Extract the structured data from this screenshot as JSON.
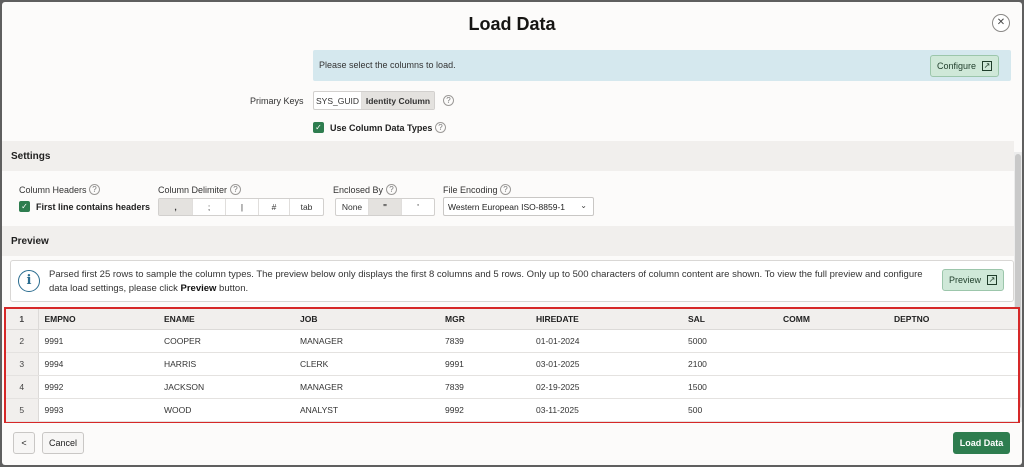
{
  "dialog": {
    "title": "Load Data",
    "close_glyph": "✕"
  },
  "banner": {
    "message": "Please select the columns to load.",
    "configure_label": "Configure"
  },
  "primary_keys": {
    "label": "Primary Keys",
    "options": [
      "SYS_GUID",
      "Identity Column"
    ],
    "selected": "Identity Column"
  },
  "use_column_data_types": {
    "label": "Use Column Data Types",
    "checked": true
  },
  "settings": {
    "title": "Settings",
    "column_headers": {
      "label": "Column Headers",
      "checkbox_label": "First line contains headers"
    },
    "column_delimiter": {
      "label": "Column Delimiter",
      "options": [
        ",",
        ";",
        "|",
        "#",
        "tab"
      ],
      "selected": ","
    },
    "enclosed_by": {
      "label": "Enclosed By",
      "options": [
        "None",
        "\"",
        "'"
      ],
      "selected": "\""
    },
    "file_encoding": {
      "label": "File Encoding",
      "value": "Western European ISO-8859-1"
    }
  },
  "preview": {
    "title": "Preview",
    "info_text_before": "Parsed first 25 rows to sample the column types. The preview below only displays the first 8 columns and 5 rows. Only up to 500 characters of column content are shown. To view the full preview and configure data load settings, please click ",
    "info_text_bold": "Preview",
    "info_text_after": " button.",
    "preview_button": "Preview"
  },
  "grid": {
    "header_row_number": "1",
    "columns": [
      "EMPNO",
      "ENAME",
      "JOB",
      "MGR",
      "HIREDATE",
      "SAL",
      "COMM",
      "DEPTNO"
    ],
    "rows": [
      {
        "n": "2",
        "cells": [
          "9991",
          "COOPER",
          "MANAGER",
          "7839",
          "01-01-2024",
          "5000",
          "",
          ""
        ]
      },
      {
        "n": "3",
        "cells": [
          "9994",
          "HARRIS",
          "CLERK",
          "9991",
          "03-01-2025",
          "2100",
          "",
          ""
        ]
      },
      {
        "n": "4",
        "cells": [
          "9992",
          "JACKSON",
          "MANAGER",
          "7839",
          "02-19-2025",
          "1500",
          "",
          ""
        ]
      },
      {
        "n": "5",
        "cells": [
          "9993",
          "WOOD",
          "ANALYST",
          "9992",
          "03-11-2025",
          "500",
          "",
          ""
        ]
      }
    ]
  },
  "footer": {
    "back_glyph": "<",
    "cancel_label": "Cancel",
    "load_label": "Load Data"
  },
  "colors": {
    "accent_green": "#2e7d4f",
    "banner_blue": "#d5e8ee",
    "highlight_red": "#d62828"
  }
}
